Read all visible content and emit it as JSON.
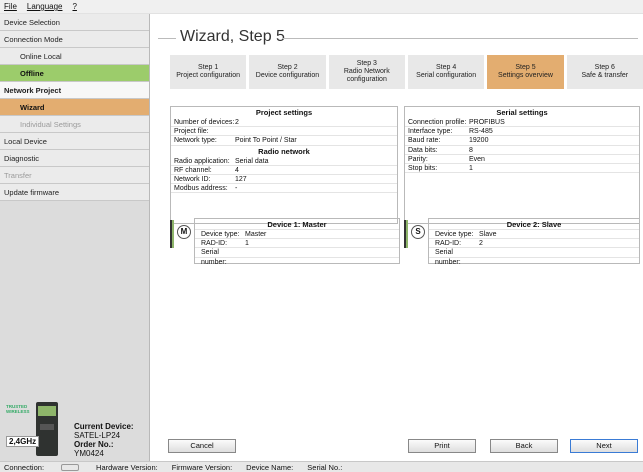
{
  "menu": {
    "file": "File",
    "language": "Language",
    "help": "?"
  },
  "sidebar": {
    "items": [
      {
        "label": "Device Selection"
      },
      {
        "label": "Connection Mode"
      },
      {
        "label": "Online Local"
      },
      {
        "label": "Offline"
      },
      {
        "label": "Network Project"
      },
      {
        "label": "Wizard"
      },
      {
        "label": "Individual Settings"
      },
      {
        "label": "Local Device"
      },
      {
        "label": "Diagnostic"
      },
      {
        "label": "Transfer"
      },
      {
        "label": "Update firmware"
      }
    ]
  },
  "device_info": {
    "ghz": "2,4GHz",
    "current_device_label": "Current Device:",
    "current_device": "SATEL-LP24",
    "order_no_label": "Order No.:",
    "order_no": "YM0424",
    "trusted_logo": "TRUSTED WIRELESS"
  },
  "wizard": {
    "title": "Wizard, Step 5",
    "steps": [
      {
        "label": "Step 1\nProject configuration"
      },
      {
        "label": "Step 2\nDevice configuration"
      },
      {
        "label": "Step 3\nRadio Network configuration"
      },
      {
        "label": "Step 4\nSerial configuration"
      },
      {
        "label": "Step 5\nSettings overview"
      },
      {
        "label": "Step 6\nSafe & transfer"
      }
    ]
  },
  "project_settings": {
    "header": "Project settings",
    "rows": [
      {
        "k": "Number of devices:",
        "v": "2"
      },
      {
        "k": "Project file:",
        "v": ""
      },
      {
        "k": "Network type:",
        "v": "Point To Point / Star"
      }
    ],
    "radio_header": "Radio network",
    "radio_rows": [
      {
        "k": "Radio application:",
        "v": "Serial data"
      },
      {
        "k": "RF channel:",
        "v": "4"
      },
      {
        "k": "Network ID:",
        "v": "127"
      },
      {
        "k": "Modbus address:",
        "v": "-"
      }
    ]
  },
  "serial_settings": {
    "header": "Serial settings",
    "rows": [
      {
        "k": "Connection profile:",
        "v": "PROFIBUS"
      },
      {
        "k": "Interface type:",
        "v": "RS-485"
      },
      {
        "k": "Baud rate:",
        "v": "19200"
      },
      {
        "k": "Data bits:",
        "v": "8"
      },
      {
        "k": "Parity:",
        "v": "Even"
      },
      {
        "k": "Stop bits:",
        "v": "1"
      }
    ]
  },
  "device1": {
    "letter": "M",
    "header": "Device 1: Master",
    "rows": [
      {
        "k": "Device type:",
        "v": "Master"
      },
      {
        "k": "RAD-ID:",
        "v": "1"
      },
      {
        "k": "Serial number:",
        "v": ""
      }
    ]
  },
  "device2": {
    "letter": "S",
    "header": "Device 2: Slave",
    "rows": [
      {
        "k": "Device type:",
        "v": "Slave"
      },
      {
        "k": "RAD-ID:",
        "v": "2"
      },
      {
        "k": "Serial number:",
        "v": ""
      }
    ]
  },
  "buttons": {
    "cancel": "Cancel",
    "print": "Print",
    "back": "Back",
    "next": "Next"
  },
  "status": {
    "connection": "Connection:",
    "hardware": "Hardware Version:",
    "firmware": "Firmware Version:",
    "device_name": "Device Name:",
    "serial": "Serial No.:"
  }
}
